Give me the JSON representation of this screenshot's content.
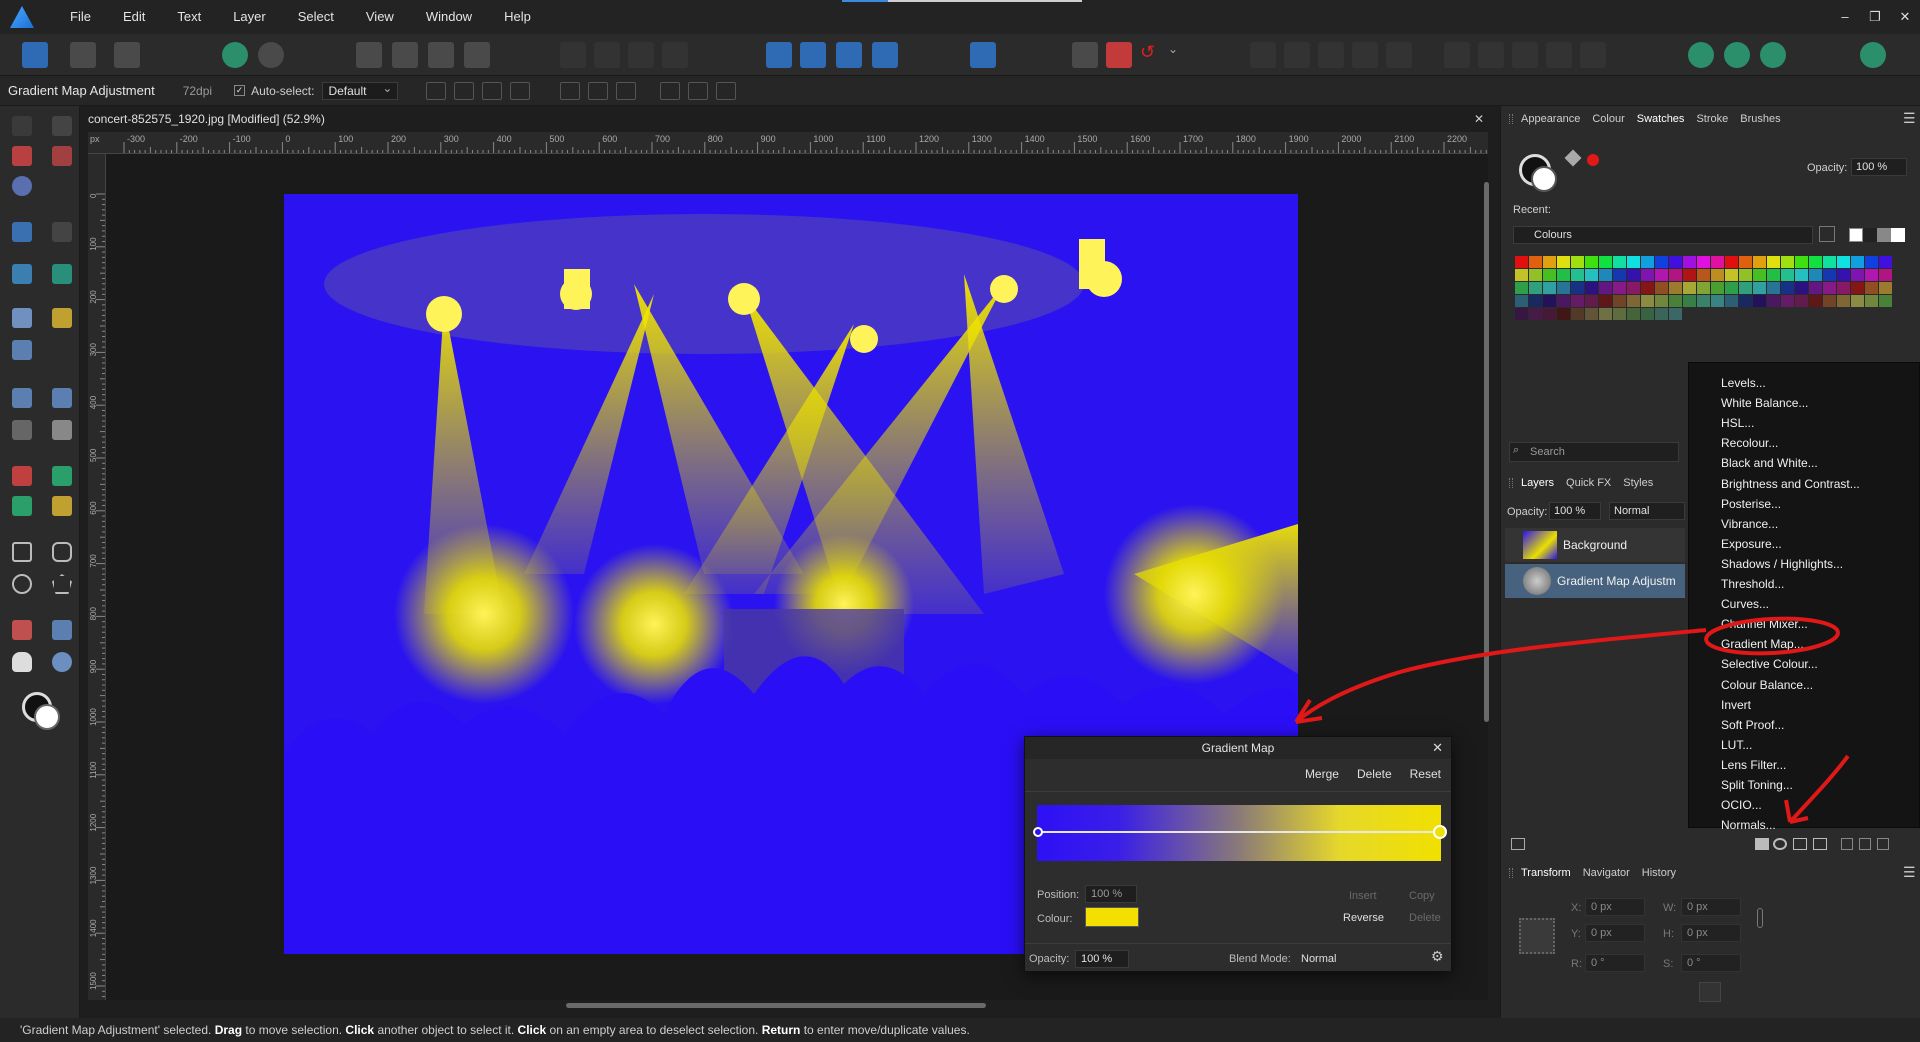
{
  "menubar": {
    "items": [
      "File",
      "Edit",
      "Text",
      "Layer",
      "Select",
      "View",
      "Window",
      "Help"
    ],
    "window_controls": [
      "–",
      "❐",
      "✕"
    ]
  },
  "context": {
    "title": "Gradient Map Adjustment",
    "dpi": "72dpi",
    "autoselect_label": "Auto-select:",
    "autoselect_value": "Default"
  },
  "document": {
    "tab_title": "concert-852575_1920.jpg [Modified] (52.9%)",
    "ruler_unit": "px",
    "ruler_h": [
      "-300",
      "-200",
      "-100",
      "0",
      "100",
      "200",
      "300",
      "400",
      "500",
      "600",
      "700",
      "800",
      "900",
      "1000",
      "1100",
      "1200",
      "1300",
      "1400",
      "1500",
      "1600",
      "1700",
      "1800",
      "1900",
      "2000",
      "2100",
      "2200"
    ],
    "ruler_v": [
      "0",
      "100",
      "200",
      "300",
      "400",
      "500",
      "600",
      "700",
      "800",
      "900",
      "1000",
      "1100",
      "1200",
      "1300",
      "1400",
      "1500"
    ]
  },
  "gradient_map": {
    "title": "Gradient Map",
    "merge": "Merge",
    "delete": "Delete",
    "reset": "Reset",
    "position_label": "Position:",
    "position_value": "100 %",
    "colour_label": "Colour:",
    "insert": "Insert",
    "copy": "Copy",
    "reverse": "Reverse",
    "delete2": "Delete",
    "opacity_label": "Opacity:",
    "opacity_value": "100 %",
    "blend_label": "Blend Mode:",
    "blend_value": "Normal",
    "colours": {
      "start": "#2d10f6",
      "end": "#f0e000"
    }
  },
  "swatches_panel": {
    "tabs": [
      "Appearance",
      "Colour",
      "Swatches",
      "Stroke",
      "Brushes"
    ],
    "active_tab": "Swatches",
    "opacity_label": "Opacity:",
    "opacity_value": "100 %",
    "recent_label": "Recent:",
    "palette": "Colours"
  },
  "layers_panel": {
    "search_placeholder": "Search",
    "tabs": [
      "Layers",
      "Quick FX",
      "Styles"
    ],
    "opacity_label": "Opacity:",
    "opacity_value": "100 %",
    "blend_value": "Normal",
    "layers": [
      "Background",
      "Gradient Map Adjustm"
    ]
  },
  "adjustments_menu": {
    "items": [
      "Levels...",
      "White Balance...",
      "HSL...",
      "Recolour...",
      "Black and White...",
      "Brightness and Contrast...",
      "Posterise...",
      "Vibrance...",
      "Exposure...",
      "Shadows / Highlights...",
      "Threshold...",
      "Curves...",
      "Channel Mixer...",
      "Gradient Map...",
      "Selective Colour...",
      "Colour Balance...",
      "Invert",
      "Soft Proof...",
      "LUT...",
      "Lens Filter...",
      "Split Toning...",
      "OCIO...",
      "Normals..."
    ],
    "highlighted": "Gradient Map..."
  },
  "transform_panel": {
    "tabs": [
      "Transform",
      "Navigator",
      "History"
    ],
    "x_label": "X:",
    "x_value": "0 px",
    "y_label": "Y:",
    "y_value": "0 px",
    "w_label": "W:",
    "w_value": "0 px",
    "h_label": "H:",
    "h_value": "0 px",
    "r_label": "R:",
    "r_value": "0 °",
    "s_label": "S:",
    "s_value": "0 °"
  },
  "status": {
    "p1": "'Gradient Map Adjustment' selected. ",
    "b1": "Drag",
    "p2": " to move selection. ",
    "b2": "Click",
    "p3": " another object to select it. ",
    "b3": "Click",
    "p4": " on an empty area to deselect selection. ",
    "b4": "Return",
    "p5": " to enter move/duplicate values."
  },
  "annotation_color": "#e01818"
}
